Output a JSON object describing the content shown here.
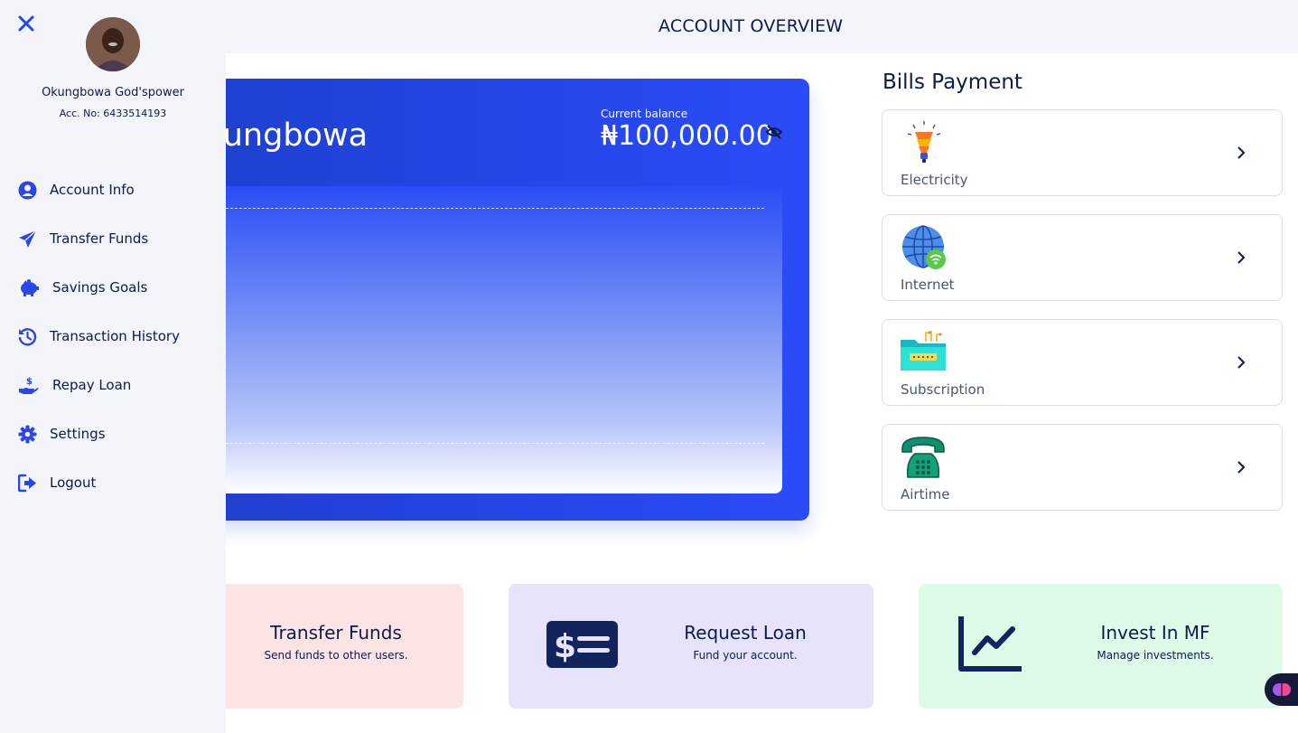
{
  "header": {
    "title": "ACCOUNT OVERVIEW"
  },
  "sidebar": {
    "user_name": "Okungbowa God'spower",
    "account_no": "Acc. No: 6433514193",
    "items": [
      {
        "label": "Account Info",
        "icon": "user-circle-icon"
      },
      {
        "label": "Transfer Funds",
        "icon": "paper-plane-icon"
      },
      {
        "label": "Savings Goals",
        "icon": "piggy-bank-icon"
      },
      {
        "label": "Transaction History",
        "icon": "history-icon"
      },
      {
        "label": "Repay Loan",
        "icon": "hand-dollar-icon"
      },
      {
        "label": "Settings",
        "icon": "gear-icon"
      },
      {
        "label": "Logout",
        "icon": "logout-icon"
      }
    ]
  },
  "balance_card": {
    "name": "Okungbowa",
    "balance_label": "Current balance",
    "balance_value": "₦100,000.00"
  },
  "bills": {
    "title": "Bills Payment",
    "items": [
      {
        "label": "Electricity",
        "icon": "lightbulb-icon"
      },
      {
        "label": "Internet",
        "icon": "globe-wifi-icon"
      },
      {
        "label": "Subscription",
        "icon": "tv-box-icon"
      },
      {
        "label": "Airtime",
        "icon": "telephone-icon"
      }
    ]
  },
  "actions": [
    {
      "title": "Transfer Funds",
      "subtitle": "Send funds to other users.",
      "color": "#fde4e4"
    },
    {
      "title": "Request Loan",
      "subtitle": "Fund your account.",
      "color": "#e6e3fb"
    },
    {
      "title": "Invest In MF",
      "subtitle": "Manage investments.",
      "color": "#ddfbe6"
    }
  ],
  "colors": {
    "primary": "#2446e6",
    "navy": "#0d1b4c",
    "accent_icon": "#2a45e8"
  }
}
